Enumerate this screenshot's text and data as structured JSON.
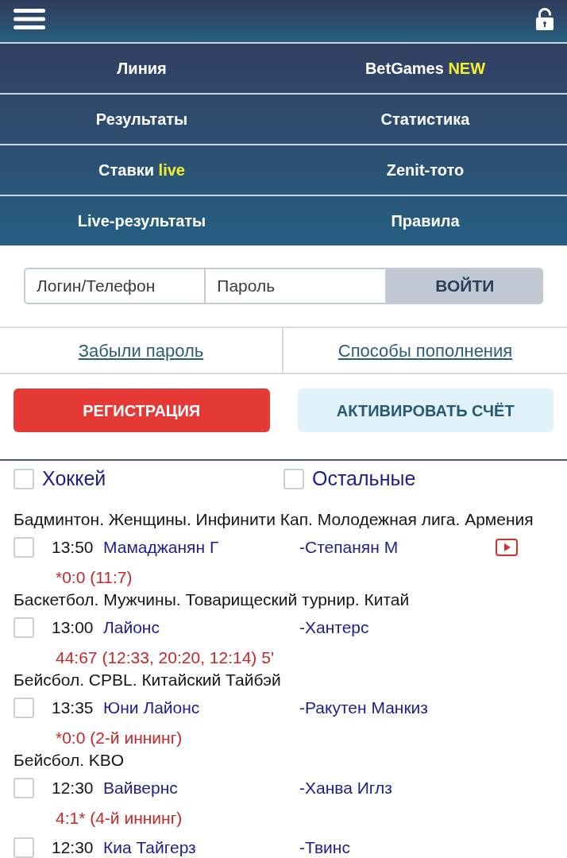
{
  "nav": [
    {
      "label": "Линия"
    },
    {
      "label": "BetGames",
      "tag": "NEW"
    },
    {
      "label": "Результаты"
    },
    {
      "label": "Статистика"
    },
    {
      "label": "Ставки",
      "tag": "live"
    },
    {
      "label": "Zenit-тото"
    },
    {
      "label": "Live-результаты"
    },
    {
      "label": "Правила"
    }
  ],
  "login": {
    "fields": [
      {
        "placeholder": "Логин/Телефон"
      },
      {
        "placeholder": "Пароль"
      }
    ],
    "submit": "ВОЙТИ"
  },
  "links": [
    "Забыли пароль",
    "Способы пополнения"
  ],
  "actions": [
    {
      "label": "РЕГИСТРАЦИЯ",
      "kind": "primary"
    },
    {
      "label": "АКТИВИРОВАТЬ СЧЁТ",
      "kind": "secondary"
    }
  ],
  "filters": [
    {
      "label": "Хоккей",
      "checked": false
    },
    {
      "label": "Остальные",
      "checked": false
    }
  ],
  "leagues": [
    {
      "title": "Бадминтон. Женщины. Инфинити Кап. Молодежная лига. Армения",
      "events": [
        {
          "checked": false,
          "time": "13:50",
          "home": "Мамаджанян Г",
          "away": "-Степанян М",
          "video": true,
          "score": "*0:0 (11:7)"
        }
      ]
    },
    {
      "title": "Баскетбол. Мужчины. Товарищеский турнир. Китай",
      "events": [
        {
          "checked": false,
          "time": "13:00",
          "home": "Лайонс",
          "away": "-Хантерс",
          "video": false,
          "score": "44:67 (12:33, 20:20, 12:14) 5'"
        }
      ]
    },
    {
      "title": "Бейсбол. CPBL. Китайский Тайбэй",
      "events": [
        {
          "checked": false,
          "time": "13:35",
          "home": "Юни Лайонс",
          "away": "-Ракутен Манкиз",
          "video": false,
          "score": "*0:0 (2-й иннинг)"
        }
      ]
    },
    {
      "title": "Бейсбол. KBO",
      "events": [
        {
          "checked": false,
          "time": "12:30",
          "home": "Вайвернс",
          "away": "-Ханва Иглз",
          "video": false,
          "score": "4:1* (4-й иннинг)"
        },
        {
          "checked": false,
          "time": "12:30",
          "home": "Киа Тайгерз",
          "away": "-Твинс",
          "video": false
        }
      ]
    }
  ]
}
